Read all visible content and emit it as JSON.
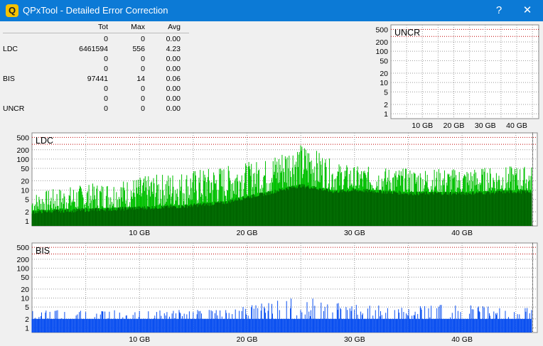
{
  "window": {
    "title": "QPxTool - Detailed Error Correction",
    "help_label": "?",
    "close_label": "✕",
    "app_icon_letter": "Q"
  },
  "stats": {
    "headers": [
      "Tot",
      "Max",
      "Avg"
    ],
    "rows": [
      {
        "label": "",
        "tot": "0",
        "max": "0",
        "avg": "0.00"
      },
      {
        "label": "LDC",
        "tot": "6461594",
        "max": "556",
        "avg": "4.23"
      },
      {
        "label": "",
        "tot": "0",
        "max": "0",
        "avg": "0.00"
      },
      {
        "label": "",
        "tot": "0",
        "max": "0",
        "avg": "0.00"
      },
      {
        "label": "BIS",
        "tot": "97441",
        "max": "14",
        "avg": "0.06"
      },
      {
        "label": "",
        "tot": "0",
        "max": "0",
        "avg": "0.00"
      },
      {
        "label": "",
        "tot": "0",
        "max": "0",
        "avg": "0.00"
      },
      {
        "label": "UNCR",
        "tot": "0",
        "max": "0",
        "avg": "0.00"
      }
    ]
  },
  "chart_data": [
    {
      "type": "bar",
      "title": "UNCR",
      "y_scale": "log",
      "yticks": [
        "500",
        "200",
        "100",
        "50",
        "20",
        "10",
        "5",
        "2",
        "1"
      ],
      "xticks": [
        "10 GB",
        "20 GB",
        "30 GB",
        "40 GB"
      ],
      "xlim_gb": [
        0,
        47
      ],
      "grid": true,
      "series": [
        {
          "values": []
        }
      ]
    },
    {
      "type": "bar",
      "title": "LDC",
      "y_scale": "log",
      "yticks": [
        "500",
        "200",
        "100",
        "50",
        "20",
        "10",
        "5",
        "2",
        "1"
      ],
      "xticks": [
        "10 GB",
        "20 GB",
        "30 GB",
        "40 GB"
      ],
      "xlim_gb": [
        0,
        47
      ],
      "grid": true,
      "colors": {
        "peak": "#00c000",
        "average": "#006400"
      },
      "profile": {
        "x_gb": [
          0,
          8,
          14,
          18,
          22,
          25,
          28,
          30,
          35,
          40,
          45,
          46.5
        ],
        "avg": [
          2,
          2.5,
          3,
          4,
          8,
          14,
          9,
          10,
          8,
          8,
          9,
          9
        ],
        "peak": [
          8,
          20,
          40,
          60,
          100,
          300,
          80,
          60,
          50,
          50,
          60,
          60
        ]
      }
    },
    {
      "type": "bar",
      "title": "BIS",
      "y_scale": "log",
      "yticks": [
        "500",
        "200",
        "100",
        "50",
        "20",
        "10",
        "5",
        "2",
        "1"
      ],
      "xticks": [
        "10 GB",
        "20 GB",
        "30 GB",
        "40 GB"
      ],
      "xlim_gb": [
        0,
        47
      ],
      "grid": true,
      "colors": {
        "bar": "#0a4ff0"
      },
      "profile": {
        "x_gb": [
          0,
          10,
          18,
          20,
          25,
          27,
          30,
          40,
          46.5
        ],
        "base": [
          2,
          2,
          2,
          2,
          2,
          2,
          2,
          2,
          2
        ],
        "peak": [
          4,
          4,
          4,
          6,
          12,
          8,
          6,
          6,
          5
        ]
      }
    }
  ]
}
